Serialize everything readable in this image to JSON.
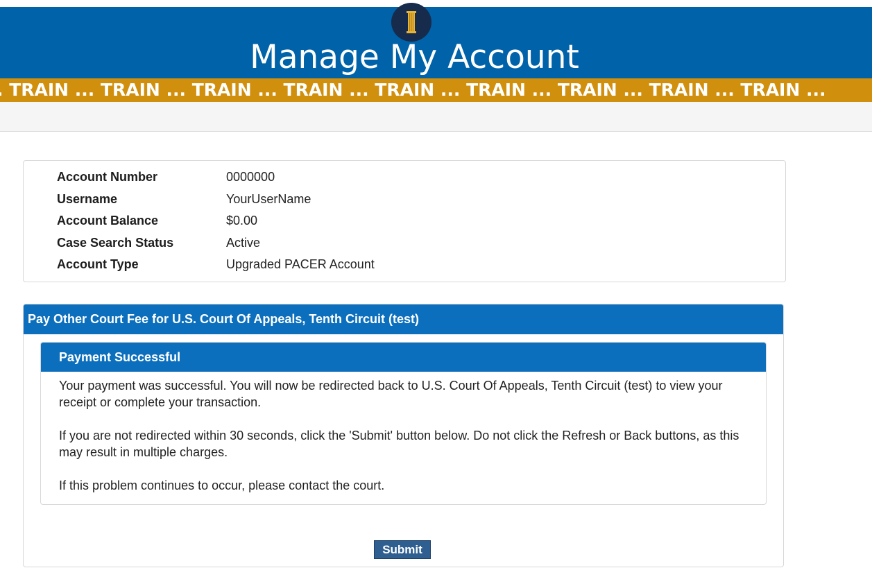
{
  "header": {
    "title": "Manage My Account",
    "logo_icon": "courthouse-column-icon",
    "banner_text": ". TRAIN ... TRAIN ... TRAIN ... TRAIN ... TRAIN ... TRAIN ... TRAIN ... TRAIN ... TRAIN ...",
    "colors": {
      "header_blue": "#0062a8",
      "banner_gold": "#d18f0e",
      "logo_navy": "#172b4d"
    }
  },
  "account": {
    "rows": [
      {
        "label": "Account Number",
        "value": "0000000"
      },
      {
        "label": "Username",
        "value": "YourUserName"
      },
      {
        "label": "Account Balance",
        "value": "$0.00"
      },
      {
        "label": "Case Search Status",
        "value": "Active"
      },
      {
        "label": "Account Type",
        "value": "Upgraded PACER Account"
      }
    ]
  },
  "fee_panel": {
    "title": "Pay Other Court Fee for U.S. Court Of Appeals, Tenth Circuit (test)",
    "success": {
      "title": "Payment Successful",
      "paragraphs": [
        "Your payment was successful. You will now be redirected back to U.S. Court Of Appeals, Tenth Circuit (test) to view your receipt or complete your transaction.",
        "If you are not redirected within 30 seconds, click the 'Submit' button below. Do not click the Refresh or Back buttons, as this may result in multiple charges.",
        "If this problem continues to occur, please contact the court."
      ]
    },
    "submit_label": "Submit",
    "accent_color": "#0b6fbd"
  }
}
